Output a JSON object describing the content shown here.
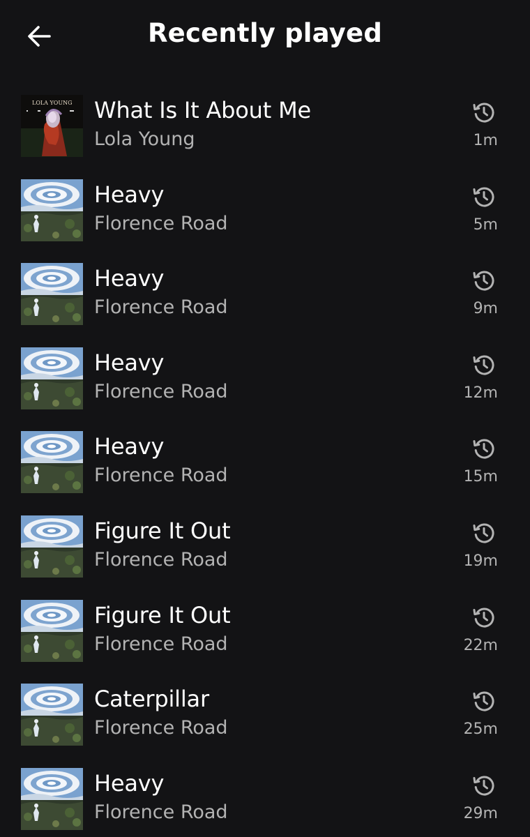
{
  "header": {
    "title": "Recently played",
    "back_icon": "arrow-left-icon"
  },
  "items": [
    {
      "title": "What Is It About Me",
      "artist": "Lola Young",
      "time": "1m",
      "cover": "lola-young-cover",
      "cover_text": "LOLA YOUNG"
    },
    {
      "title": "Heavy",
      "artist": "Florence Road",
      "time": "5m",
      "cover": "florence-road-cover"
    },
    {
      "title": "Heavy",
      "artist": "Florence Road",
      "time": "9m",
      "cover": "florence-road-cover"
    },
    {
      "title": "Heavy",
      "artist": "Florence Road",
      "time": "12m",
      "cover": "florence-road-cover"
    },
    {
      "title": "Heavy",
      "artist": "Florence Road",
      "time": "15m",
      "cover": "florence-road-cover"
    },
    {
      "title": "Figure It Out",
      "artist": "Florence Road",
      "time": "19m",
      "cover": "florence-road-cover"
    },
    {
      "title": "Figure It Out",
      "artist": "Florence Road",
      "time": "22m",
      "cover": "florence-road-cover"
    },
    {
      "title": "Caterpillar",
      "artist": "Florence Road",
      "time": "25m",
      "cover": "florence-road-cover"
    },
    {
      "title": "Heavy",
      "artist": "Florence Road",
      "time": "29m",
      "cover": "florence-road-cover"
    }
  ],
  "colors": {
    "background": "#131315",
    "primary_text": "#ffffff",
    "secondary_text": "#b3b3b3",
    "icon": "#b3b3b3"
  },
  "history_icon": "history-clock-icon"
}
